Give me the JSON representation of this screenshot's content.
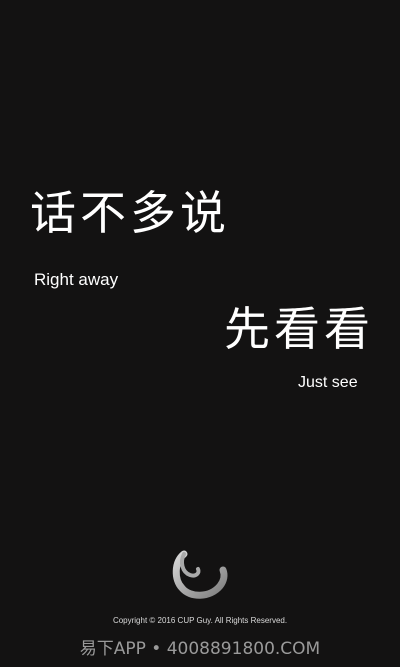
{
  "headline1": {
    "chinese": "话不多说",
    "english": "Right away"
  },
  "headline2": {
    "chinese": "先看看",
    "english": "Just see"
  },
  "logo_icon": "swirl-logo-icon",
  "footer": {
    "copyright": "Copyright © 2016 CUP Guy. All Rights Reserved."
  },
  "watermark": {
    "text": "易下APP • 4008891800.COM"
  },
  "colors": {
    "background": "#131212",
    "text": "#ffffff",
    "logo_gray": "#9e9e9e",
    "watermark": "#9a9a9a"
  }
}
